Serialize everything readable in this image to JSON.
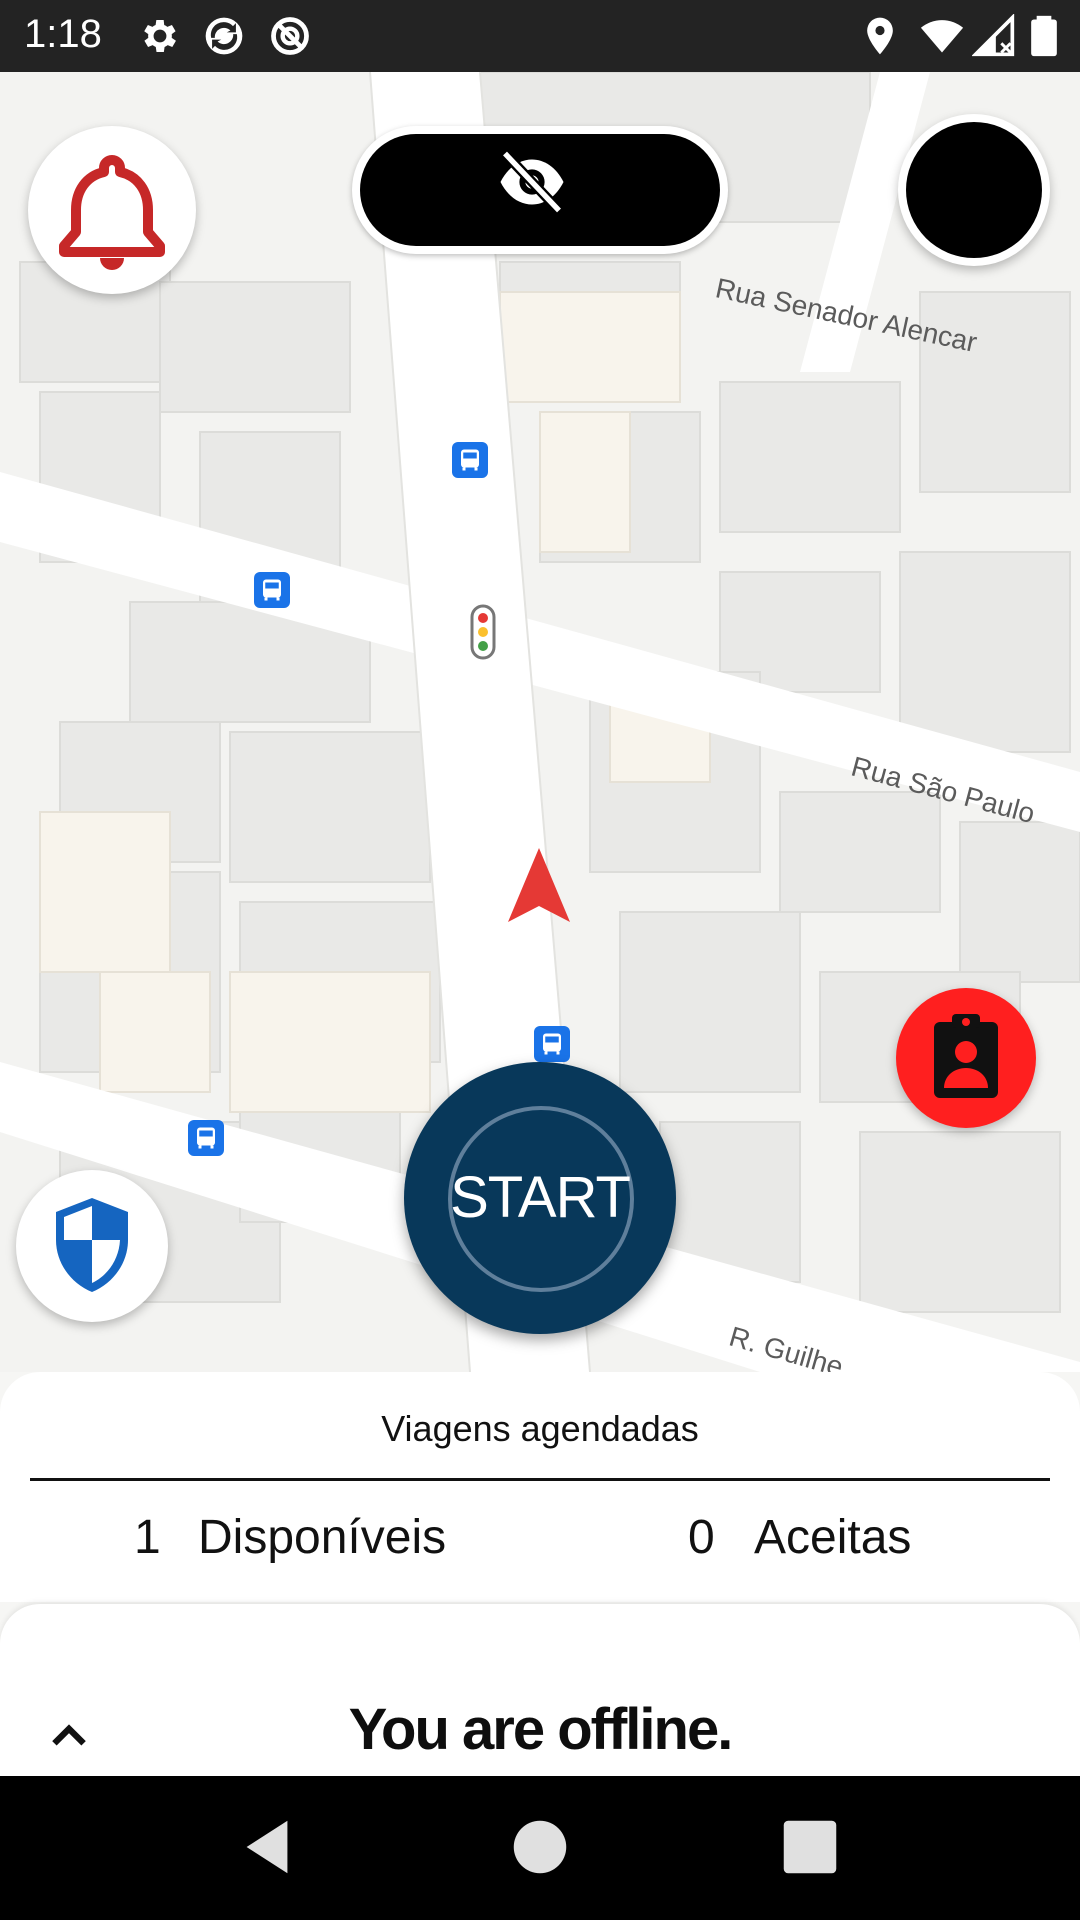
{
  "status_bar": {
    "time": "1:18",
    "icons": [
      "gear-icon",
      "sync-icon",
      "do-not-disturb-icon",
      "location-icon",
      "wifi-icon",
      "cell-signal-icon",
      "battery-icon"
    ]
  },
  "map": {
    "streets": [
      "Rua Senador Alencar",
      "Rua São Paulo",
      "R. Guilhe"
    ],
    "markers": [
      "bus-stop-icon",
      "traffic-light-icon",
      "navigation-arrow-icon"
    ]
  },
  "buttons": {
    "start_label": "START",
    "bell_color": "#c62828",
    "shield_color": "#1565c0",
    "report_color": "#ff1f1f",
    "start_color": "#08385a"
  },
  "scheduled": {
    "title": "Viagens agendadas",
    "available_count": "1",
    "available_label": "Disponíveis",
    "accepted_count": "0",
    "accepted_label": "Aceitas"
  },
  "offline": {
    "message": "You are offline."
  },
  "nav": {
    "icons": [
      "back-icon",
      "home-icon",
      "recents-icon"
    ]
  }
}
